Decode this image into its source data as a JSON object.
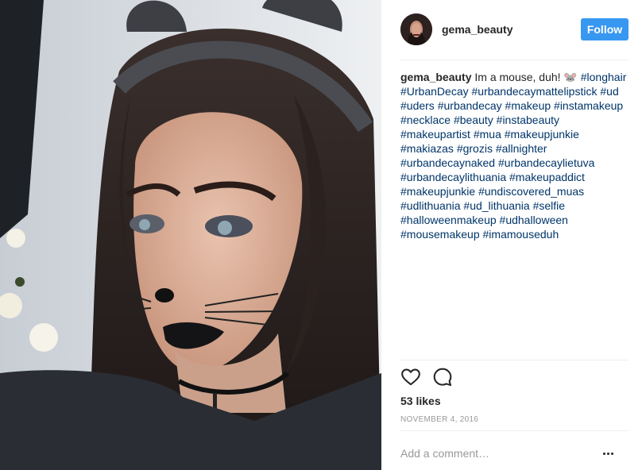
{
  "post": {
    "username": "gema_beauty",
    "follow_label": "Follow",
    "caption": {
      "username": "gema_beauty",
      "text": " Im a mouse, duh! 🐭 ",
      "hashtags": [
        "#longhair",
        "#UrbanDecay",
        "#urbandecaymattelipstick",
        "#ud",
        "#uders",
        "#urbandecay",
        "#makeup",
        "#instamakeup",
        "#necklace",
        "#beauty",
        "#instabeauty",
        "#makeupartist",
        "#mua",
        "#makeupjunkie",
        "#makiazas",
        "#grozis",
        "#allnighter",
        "#urbandecaynaked",
        "#urbandecaylietuva",
        "#urbandecaylithuania",
        "#makeupaddict",
        "#makeupjunkie",
        "#undiscovered_muas",
        "#udlithuania",
        "#ud_lithuania",
        "#selfie",
        "#halloweenmakeup",
        "#udhalloween",
        "#mousemakeup",
        "#imamouseduh"
      ]
    },
    "likes": "53 likes",
    "date": "NOVEMBER 4, 2016",
    "comment_placeholder": "Add a comment…",
    "icons": {
      "like": "heart-icon",
      "comment": "comment-bubble-icon",
      "more": "more-options-icon"
    },
    "colors": {
      "follow": "#3897f0",
      "hashtag": "#003569",
      "muted": "#999999",
      "text": "#262626"
    }
  }
}
